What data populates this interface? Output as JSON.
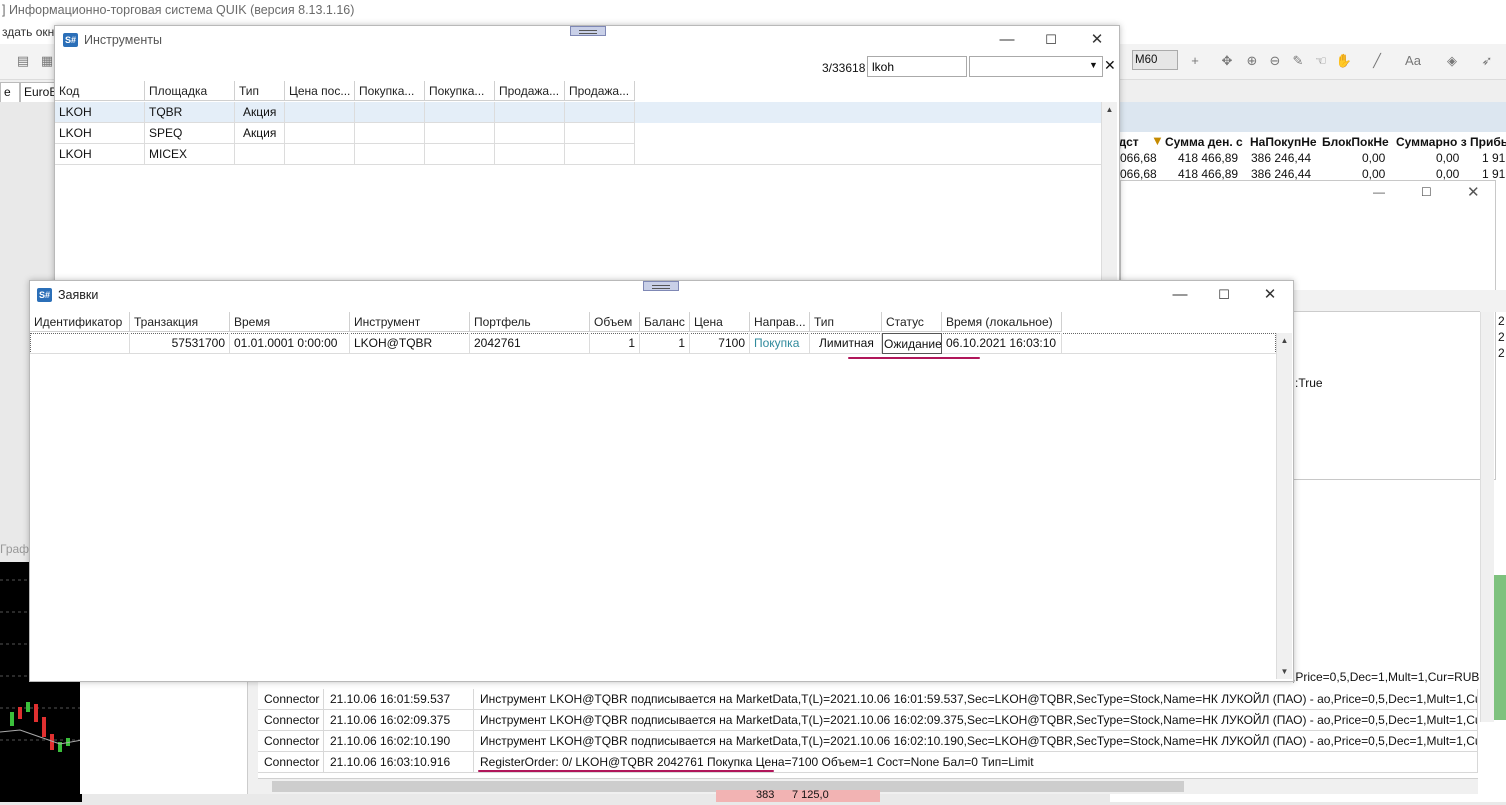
{
  "quik": {
    "title": "] Информационно-торговая система QUIK (версия 8.13.1.16)",
    "menu_partial": "здать окно",
    "timeframe": "M60",
    "tabs": [
      "е",
      "EuroB"
    ],
    "chart_label": "Граф"
  },
  "bg_table": {
    "headers": [
      "едст",
      "Сумма ден. с",
      "НаПокупНе",
      "БлокПокНе",
      "Суммарно з",
      "Прибы"
    ],
    "rows": [
      [
        "066,68",
        "418 466,89",
        "386 246,44",
        "0,00",
        "0,00",
        "1 91"
      ],
      [
        "066,68",
        "418 466,89",
        "386 246,44",
        "0,00",
        "0,00",
        "1 91"
      ]
    ],
    "fragment_true": ":True",
    "edge_values": [
      "2",
      "2",
      "2"
    ],
    "bottom_values": [
      "383",
      "7 125,0"
    ]
  },
  "instruments": {
    "title": "Инструменты",
    "count": "3/33618",
    "search_value": "lkoh",
    "filter_value": "",
    "columns": [
      "Код",
      "Площадка",
      "Тип",
      "Цена пос...",
      "Покупка...",
      "Покупка...",
      "Продажа...",
      "Продажа..."
    ],
    "rows": [
      [
        "LKOH",
        "TQBR",
        "Акция",
        "",
        "",
        "",
        "",
        ""
      ],
      [
        "LKOH",
        "SPEQ",
        "Акция",
        "",
        "",
        "",
        "",
        ""
      ],
      [
        "LKOH",
        "MICEX",
        "",
        "",
        "",
        "",
        "",
        ""
      ]
    ]
  },
  "orders": {
    "title": "Заявки",
    "columns": [
      "Идентификатор",
      "Транзакция",
      "Время",
      "Инструмент",
      "Портфель",
      "Объем",
      "Баланс",
      "Цена",
      "Направ...",
      "Тип",
      "Статус",
      "Время (локальное)"
    ],
    "rows": [
      [
        "",
        "57531700",
        "01.01.0001 0:00:00",
        "LKOH@TQBR",
        "2042761",
        "1",
        "1",
        "7100",
        "Покупка",
        "Лимитная",
        "Ожидание",
        "06.10.2021 16:03:10"
      ]
    ],
    "accent_color": "#2f8a9c",
    "underline_color": "#b0165a"
  },
  "log": {
    "rows": [
      [
        "Connector",
        "21.10.06 16:01:59.537",
        "Инструмент LKOH@TQBR подписывается на MarketData,T(L)=2021.10.06 16:01:59.537,Sec=LKOH@TQBR,SecType=Stock,Name=НК ЛУКОЙЛ (ПАО) - ао,Price=0,5,Dec=1,Mult=1,Cur=RUB"
      ],
      [
        "Connector",
        "21.10.06 16:02:09.375",
        "Инструмент LKOH@TQBR подписывается на MarketData,T(L)=2021.10.06 16:02:09.375,Sec=LKOH@TQBR,SecType=Stock,Name=НК ЛУКОЙЛ (ПАО) - ао,Price=0,5,Dec=1,Mult=1,Cur=RUB"
      ],
      [
        "Connector",
        "21.10.06 16:02:10.190",
        "Инструмент LKOH@TQBR подписывается на MarketData,T(L)=2021.10.06 16:02:10.190,Sec=LKOH@TQBR,SecType=Stock,Name=НК ЛУКОЙЛ (ПАО) - ао,Price=0,5,Dec=1,Mult=1,Cur=RUB"
      ],
      [
        "Connector",
        "21.10.06 16:03:10.916",
        "RegisterOrder: 0/ LKOH@TQBR 2042761 Покупка Цена=7100 Объем=1 Сост=None Бал=0 Тип=Limit"
      ]
    ],
    "partial_row": ",Price=0,5,Dec=1,Mult=1,Cur=RUB"
  }
}
